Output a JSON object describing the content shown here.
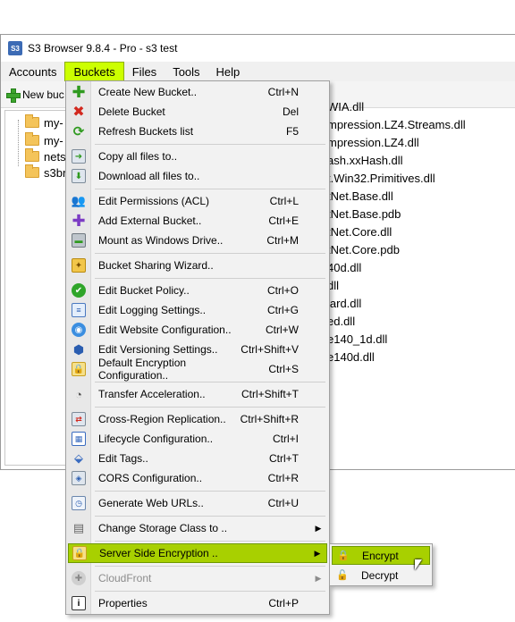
{
  "window": {
    "title": "S3 Browser 9.8.4 - Pro - s3 test",
    "app_icon": "S3"
  },
  "menubar": [
    "Accounts",
    "Buckets",
    "Files",
    "Tools",
    "Help"
  ],
  "toolbar": {
    "new_bucket": "New buc"
  },
  "tree": [
    "my-",
    "my-",
    "nets",
    "s3br"
  ],
  "files": [
    "WIA.dll",
    "mpression.LZ4.Streams.dll",
    "mpression.LZ4.dll",
    "ash.xxHash.dll",
    "t.Win32.Primitives.dll",
    "tNet.Base.dll",
    "tNet.Base.pdb",
    "tNet.Core.dll",
    "tNet.Core.pdb",
    "40d.dll",
    "dll",
    "lard.dll",
    "ed.dll",
    "e140_1d.dll",
    "e140d.dll"
  ],
  "menu": [
    {
      "label": "Create New Bucket..",
      "shortcut": "Ctrl+N",
      "icon": "plus-icon"
    },
    {
      "label": "Delete Bucket",
      "shortcut": "Del",
      "icon": "delete-icon"
    },
    {
      "label": "Refresh Buckets list",
      "shortcut": "F5",
      "icon": "refresh-icon"
    },
    {
      "label": "Copy all files to..",
      "shortcut": "",
      "icon": "copy-icon"
    },
    {
      "label": "Download all files to..",
      "shortcut": "",
      "icon": "download-icon"
    },
    {
      "label": "Edit Permissions (ACL)",
      "shortcut": "Ctrl+L",
      "icon": "users-icon"
    },
    {
      "label": "Add External Bucket..",
      "shortcut": "Ctrl+E",
      "icon": "add-external-icon"
    },
    {
      "label": "Mount as Windows Drive..",
      "shortcut": "Ctrl+M",
      "icon": "drive-icon"
    },
    {
      "label": "Bucket Sharing Wizard..",
      "shortcut": "",
      "icon": "sharing-icon"
    },
    {
      "label": "Edit Bucket Policy..",
      "shortcut": "Ctrl+O",
      "icon": "policy-icon"
    },
    {
      "label": "Edit Logging Settings..",
      "shortcut": "Ctrl+G",
      "icon": "logging-icon"
    },
    {
      "label": "Edit Website Configuration..",
      "shortcut": "Ctrl+W",
      "icon": "website-icon"
    },
    {
      "label": "Edit Versioning Settings..",
      "shortcut": "Ctrl+Shift+V",
      "icon": "versioning-icon"
    },
    {
      "label": "Default Encryption Configuration..",
      "shortcut": "Ctrl+S",
      "icon": "encryption-icon"
    },
    {
      "label": "Transfer Acceleration..",
      "shortcut": "Ctrl+Shift+T",
      "icon": "gauge-icon"
    },
    {
      "label": "Cross-Region Replication..",
      "shortcut": "Ctrl+Shift+R",
      "icon": "replication-icon"
    },
    {
      "label": "Lifecycle Configuration..",
      "shortcut": "Ctrl+I",
      "icon": "calendar-icon"
    },
    {
      "label": "Edit Tags..",
      "shortcut": "Ctrl+T",
      "icon": "tag-icon"
    },
    {
      "label": "CORS Configuration..",
      "shortcut": "Ctrl+R",
      "icon": "cors-icon"
    },
    {
      "label": "Generate Web URLs..",
      "shortcut": "Ctrl+U",
      "icon": "url-icon"
    },
    {
      "label": "Change Storage Class to ..",
      "shortcut": "",
      "icon": "storage-icon",
      "submenu": true
    },
    {
      "label": "Server Side Encryption ..",
      "shortcut": "",
      "icon": "sse-icon",
      "submenu": true,
      "highlighted": true
    },
    {
      "label": "CloudFront",
      "shortcut": "",
      "icon": "cloudfront-icon",
      "submenu": true,
      "disabled": true
    },
    {
      "label": "Properties",
      "shortcut": "Ctrl+P",
      "icon": "info-icon"
    }
  ],
  "submenu": [
    {
      "label": "Encrypt",
      "icon": "lock-icon",
      "highlighted": true
    },
    {
      "label": "Decrypt",
      "icon": "unlock-icon"
    }
  ],
  "colors": {
    "highlight": "#a8d000",
    "active_menu": "#ccff00"
  }
}
